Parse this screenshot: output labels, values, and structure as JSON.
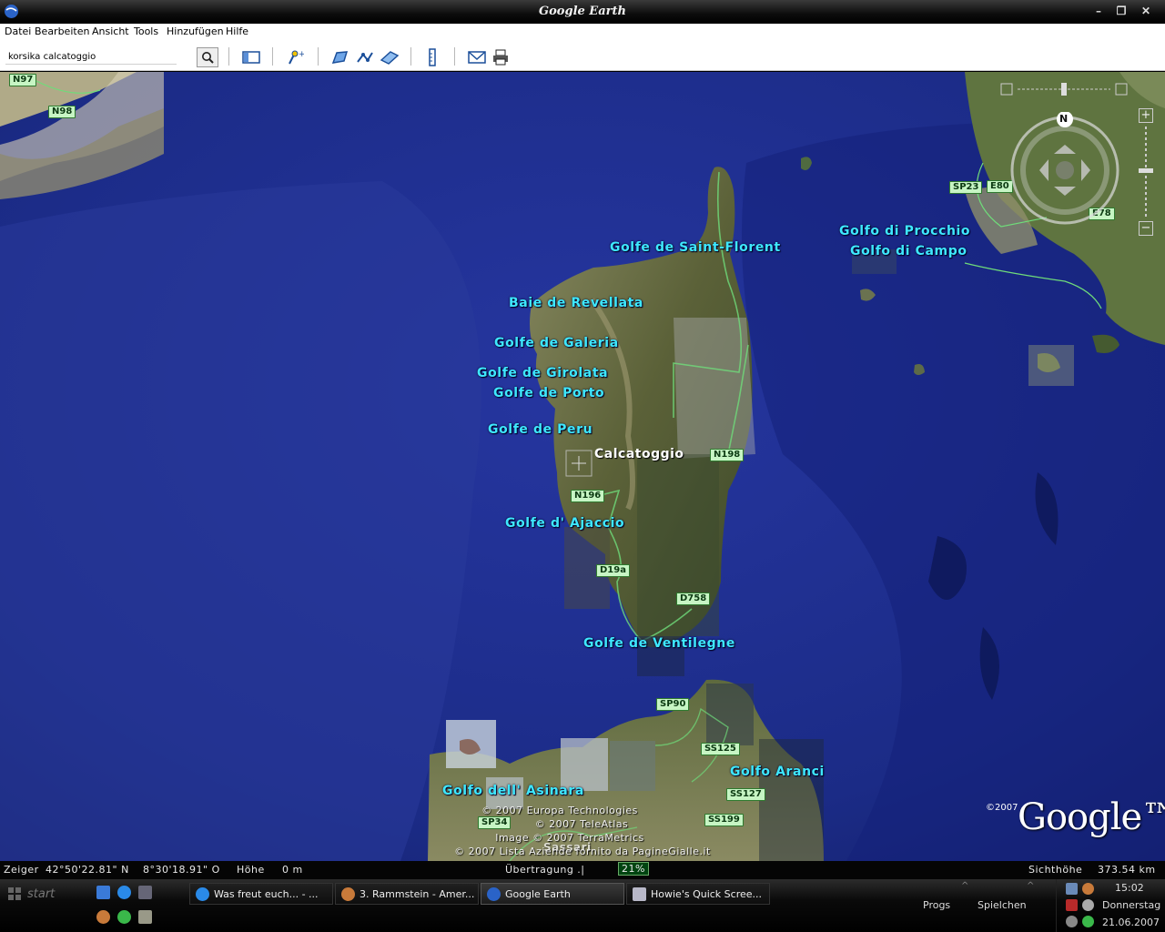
{
  "window": {
    "title": "Google Earth",
    "min": "–",
    "max": "❐",
    "close": "✕"
  },
  "menu": [
    "Datei",
    "Bearbeiten",
    "Ansicht",
    "Tools",
    "Hinzufügen",
    "Hilfe"
  ],
  "toolbar": {
    "search_value": "korsika calcatoggio"
  },
  "icons": {
    "search": "search-icon",
    "sidebar": "sidebar-toggle-icon",
    "placemark": "placemark-icon",
    "polygon": "polygon-icon",
    "path": "path-icon",
    "overlay": "image-overlay-icon",
    "ruler": "ruler-icon",
    "email": "email-icon",
    "print": "print-icon"
  },
  "map": {
    "gulf_labels": [
      "Golfe de Saint-Florent",
      "Baie de Revellata",
      "Golfe de Galeria",
      "Golfe de Girolata",
      "Golfe de Porto",
      "Golfe de Peru",
      "Golfe d' Ajaccio",
      "Golfe de Ventilegne",
      "Golfo dell' Asinara",
      "Golfo Aranci",
      "Golfo di Procchio",
      "Golfo di Campo"
    ],
    "town": "Calcatoggio",
    "roads": [
      "N97",
      "N98",
      "SP23",
      "E80",
      "E78",
      "N198",
      "N196",
      "D19a",
      "D758",
      "SP90",
      "SS125",
      "SS127",
      "SP34",
      "SS199"
    ],
    "partial_label": "Sassari",
    "credits": [
      "© 2007 Europa Technologies",
      "© 2007 TeleAtlas",
      "Image © 2007 TerraMetrics",
      "© 2007 Lista Aziende fornito da PagineGialle.it"
    ],
    "logo_copyright": "©2007",
    "logo": "Google™",
    "compass_north": "N",
    "zoom_in": "+",
    "zoom_out": "−"
  },
  "status": {
    "pointer_label": "Zeiger",
    "lat": "42°50'22.81\" N",
    "lon": "8°30'18.91\" O",
    "height_label": "Höhe",
    "height_value": "0 m",
    "streaming_label": "Übertragung .|",
    "streaming_percent": "21%",
    "eye_label": "Sichthöhe",
    "eye_value": "373.54 km"
  },
  "taskbar": {
    "start": "start",
    "tasks": [
      "Was freut euch... - ...",
      "3. Rammstein - Amer...",
      "Google Earth",
      "Howie's Quick Scree..."
    ],
    "toolbars": [
      "Progs",
      "Spielchen"
    ],
    "time": "15:02",
    "day": "Donnerstag",
    "date": "21.06.2007"
  },
  "colors": {
    "sea": "#1e2c8a",
    "label": "#3ee8ff",
    "road_bg": "#c7f5c4"
  }
}
